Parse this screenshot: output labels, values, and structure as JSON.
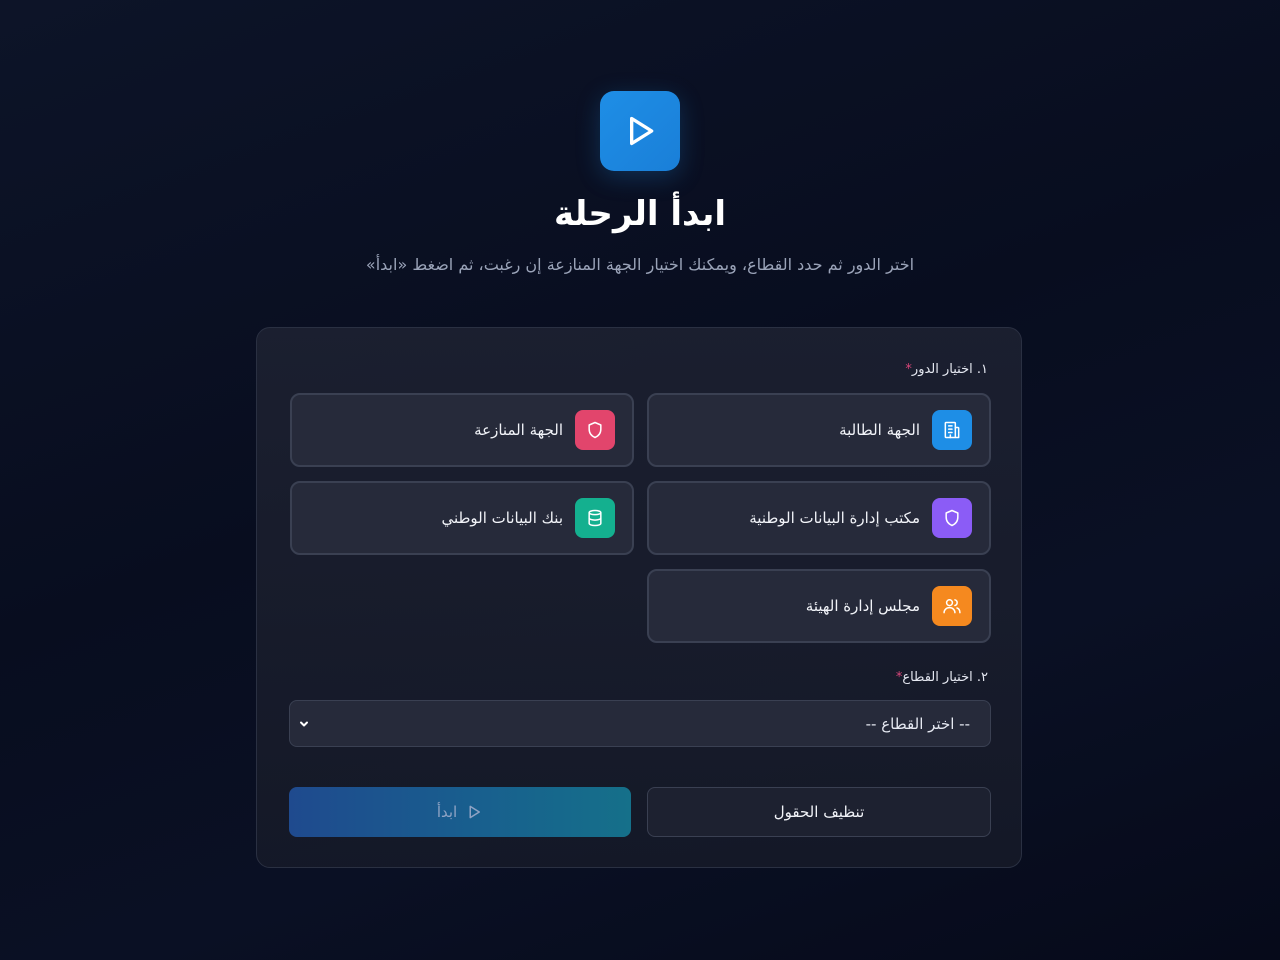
{
  "header": {
    "icon": "play-icon",
    "title": "ابدأ الرحلة",
    "subtitle": "اختر الدور ثم حدد القطاع، ويمكنك اختيار الجهة المنازعة إن رغبت، ثم اضغط «ابدأ»"
  },
  "form": {
    "role_label": "١. اختيار الدور",
    "sector_label": "٢. اختيار القطاع",
    "required_mark": "*",
    "roles": [
      {
        "label": "الجهة الطالبة",
        "icon": "building-icon",
        "color": "#1e8ee6"
      },
      {
        "label": "الجهة المنازعة",
        "icon": "shield-icon",
        "color": "#e2456c"
      },
      {
        "label": "مكتب إدارة البيانات الوطنية",
        "icon": "shield-icon",
        "color": "#8b5cf6"
      },
      {
        "label": "بنك البيانات الوطني",
        "icon": "database-icon",
        "color": "#14b08f"
      },
      {
        "label": "مجلس إدارة الهيئة",
        "icon": "users-icon",
        "color": "#f5891f"
      }
    ],
    "sector_select": {
      "selected": "-- اختر القطاع --"
    },
    "clear_button": "تنظيف الحقول",
    "start_button": "ابدأ"
  }
}
